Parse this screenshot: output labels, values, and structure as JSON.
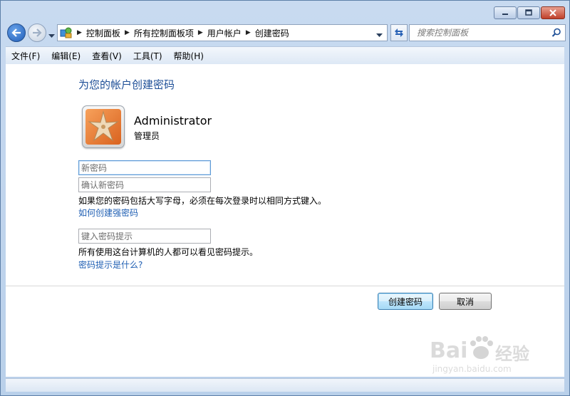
{
  "window": {
    "caption_buttons": [
      "minimize-icon",
      "maximize-icon",
      "close-icon"
    ]
  },
  "nav": {
    "breadcrumbs": [
      "控制面板",
      "所有控制面板项",
      "用户帐户",
      "创建密码"
    ],
    "search_placeholder": "搜索控制面板"
  },
  "menu": {
    "items": [
      "文件(F)",
      "编辑(E)",
      "查看(V)",
      "工具(T)",
      "帮助(H)"
    ]
  },
  "main": {
    "heading": "为您的帐户创建密码",
    "user": {
      "name": "Administrator",
      "role": "管理员"
    },
    "fields": {
      "new_password_placeholder": "新密码",
      "confirm_password_placeholder": "确认新密码",
      "hint_placeholder": "键入密码提示"
    },
    "case_note": "如果您的密码包括大写字母，必须在每次登录时以相同方式键入。",
    "strong_password_link": "如何创建强密码",
    "hint_note": "所有使用这台计算机的人都可以看见密码提示。",
    "hint_link": "密码提示是什么?",
    "buttons": {
      "create": "创建密码",
      "cancel": "取消"
    }
  },
  "watermark": {
    "brand": "Bai",
    "brand_suffix": "经验",
    "url": "jingyan.baidu.com"
  },
  "colors": {
    "heading": "#1e4f97",
    "link": "#1f5fb3",
    "frame": "#b9d0ea"
  }
}
